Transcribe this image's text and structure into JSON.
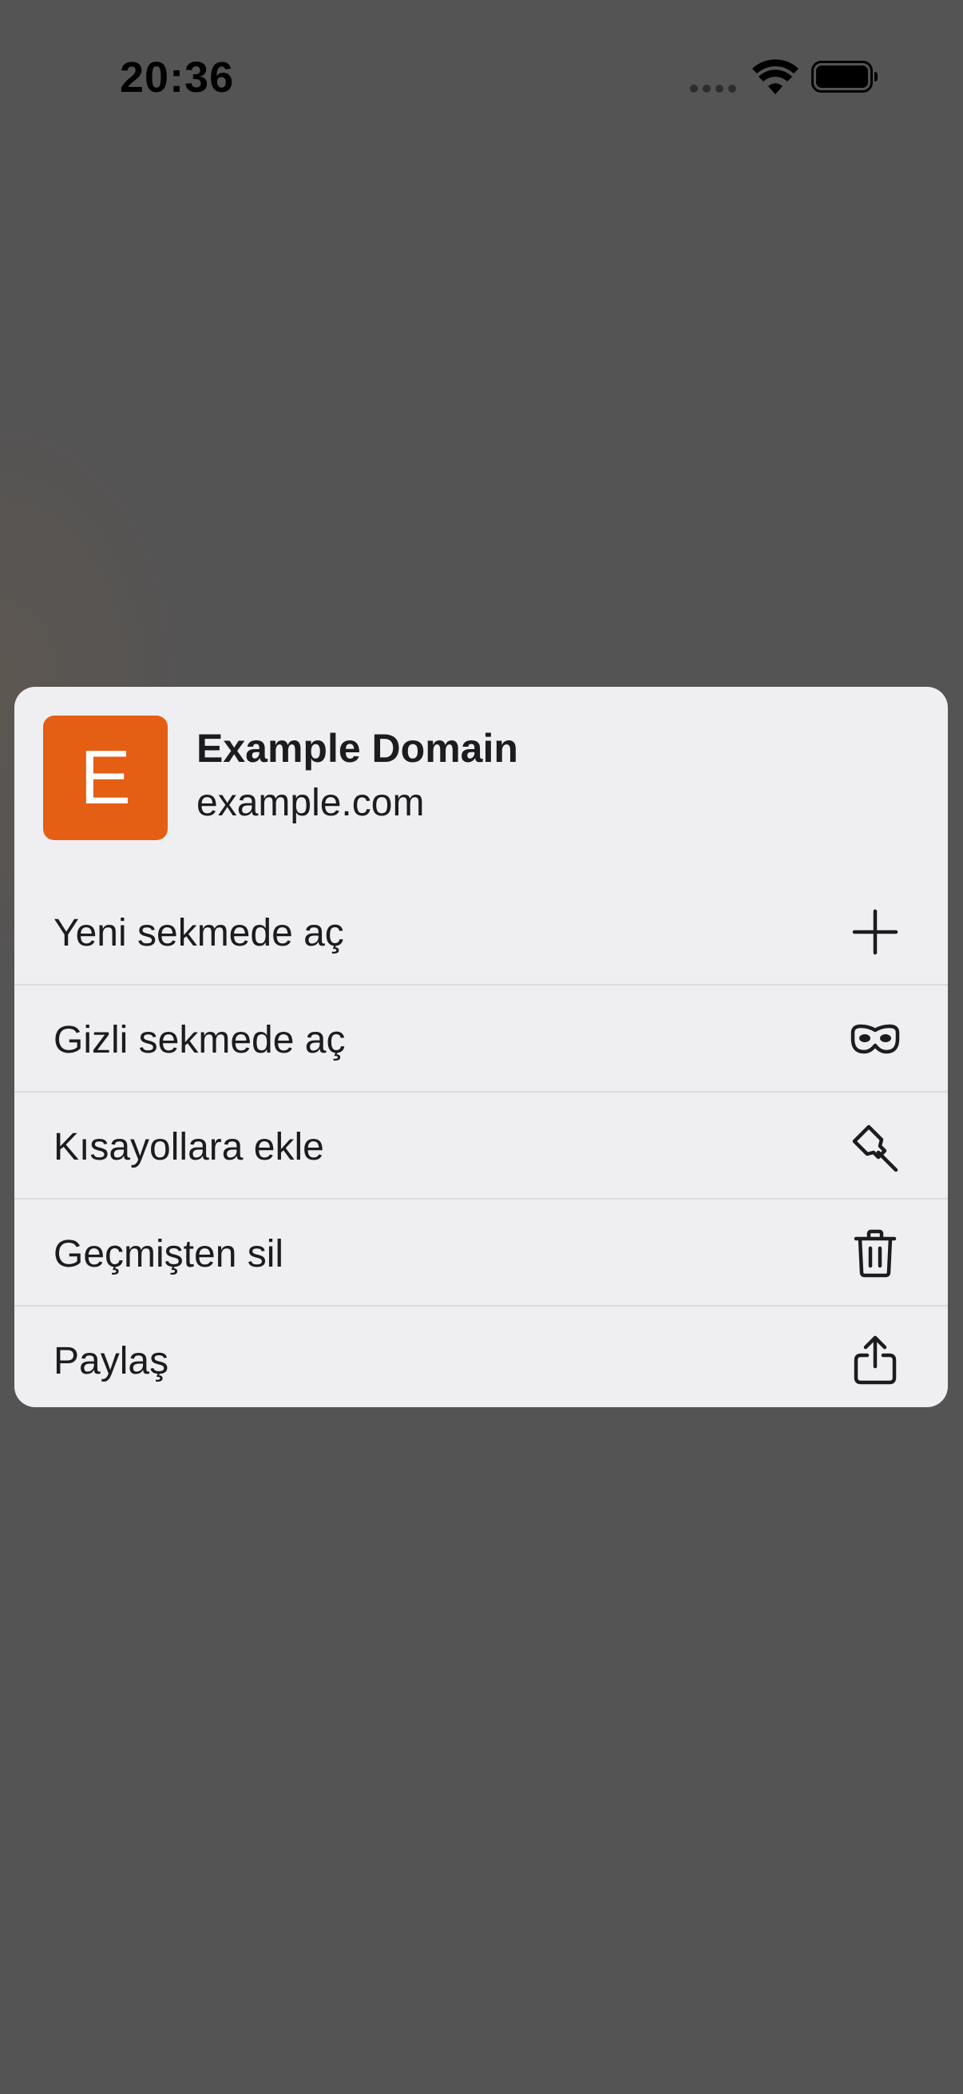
{
  "status_bar": {
    "time": "20:36"
  },
  "preview": {
    "avatar_letter": "E",
    "avatar_color": "#e45e14",
    "title": "Example Domain",
    "url": "example.com"
  },
  "menu": {
    "items": [
      {
        "label": "Yeni sekmede aç",
        "icon": "plus-icon"
      },
      {
        "label": "Gizli sekmede aç",
        "icon": "incognito-mask-icon"
      },
      {
        "label": "Kısayollara ekle",
        "icon": "pin-icon"
      },
      {
        "label": "Geçmişten sil",
        "icon": "trash-icon"
      },
      {
        "label": "Paylaş",
        "icon": "share-icon"
      }
    ]
  }
}
